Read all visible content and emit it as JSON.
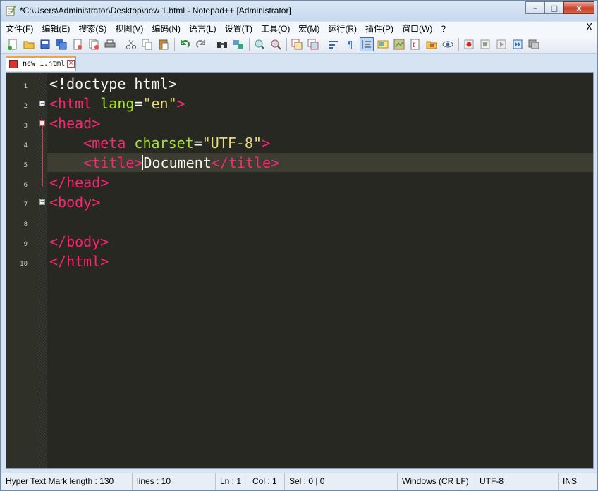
{
  "window": {
    "title": "*C:\\Users\\Administrator\\Desktop\\new 1.html - Notepad++ [Administrator]",
    "minimize_glyph": "–",
    "maximize_glyph": "□",
    "close_glyph": "x"
  },
  "menu": {
    "items": [
      "文件(F)",
      "编辑(E)",
      "搜索(S)",
      "视图(V)",
      "编码(N)",
      "语言(L)",
      "设置(T)",
      "工具(O)",
      "宏(M)",
      "运行(R)",
      "插件(P)",
      "窗口(W)",
      "?"
    ],
    "close_label": "X"
  },
  "toolbar": {
    "icons": [
      "new-file-icon",
      "open-file-icon",
      "save-icon",
      "save-all-icon",
      "close-icon",
      "close-all-icon",
      "print-icon",
      "cut-icon",
      "copy-icon",
      "paste-icon",
      "undo-icon",
      "redo-icon",
      "find-icon",
      "replace-icon",
      "zoom-in-icon",
      "zoom-out-icon",
      "sync-vertical-icon",
      "sync-horizontal-icon",
      "word-wrap-icon",
      "show-all-chars-icon",
      "indent-guide-icon",
      "user-defined-lang-icon",
      "doc-map-icon",
      "function-list-icon",
      "folder-workspace-icon",
      "monitoring-icon",
      "record-macro-icon",
      "stop-record-icon",
      "play-macro-icon",
      "run-multiple-icon",
      "save-macro-icon"
    ]
  },
  "tab": {
    "label": "new 1.html"
  },
  "editor": {
    "line_numbers": [
      "1",
      "2",
      "3",
      "4",
      "5",
      "6",
      "7",
      "8",
      "9",
      "10"
    ],
    "lines": {
      "l1": {
        "doctype": "<!doctype html>"
      },
      "l2": {
        "open": "<html ",
        "attr": "lang",
        "eq": "=",
        "val": "\"en\"",
        "close": ">"
      },
      "l3": {
        "tag": "<head>"
      },
      "l4": {
        "indent": "    ",
        "open": "<meta ",
        "attr": "charset",
        "eq": "=",
        "val": "\"UTF-8\"",
        "close": ">"
      },
      "l5": {
        "indent": "    ",
        "open": "<title>",
        "text": "Document",
        "close": "</title>"
      },
      "l6": {
        "tag": "</head>"
      },
      "l7": {
        "tag": "<body>"
      },
      "l9": {
        "tag": "</body>"
      },
      "l10": {
        "tag": "</html>"
      }
    }
  },
  "status": {
    "doc_info": "Hyper Text Mark length : 130",
    "lines": "lines : 10",
    "ln": "Ln : 1",
    "col": "Col : 1",
    "sel": "Sel : 0 | 0",
    "eol": "Windows (CR LF)",
    "encoding": "UTF-8",
    "mode": "INS"
  },
  "colors": {
    "editor_bg": "#272822",
    "tag": "#f92672",
    "attribute": "#a6e22e",
    "string": "#e6db74",
    "text": "#f8f8f2"
  }
}
